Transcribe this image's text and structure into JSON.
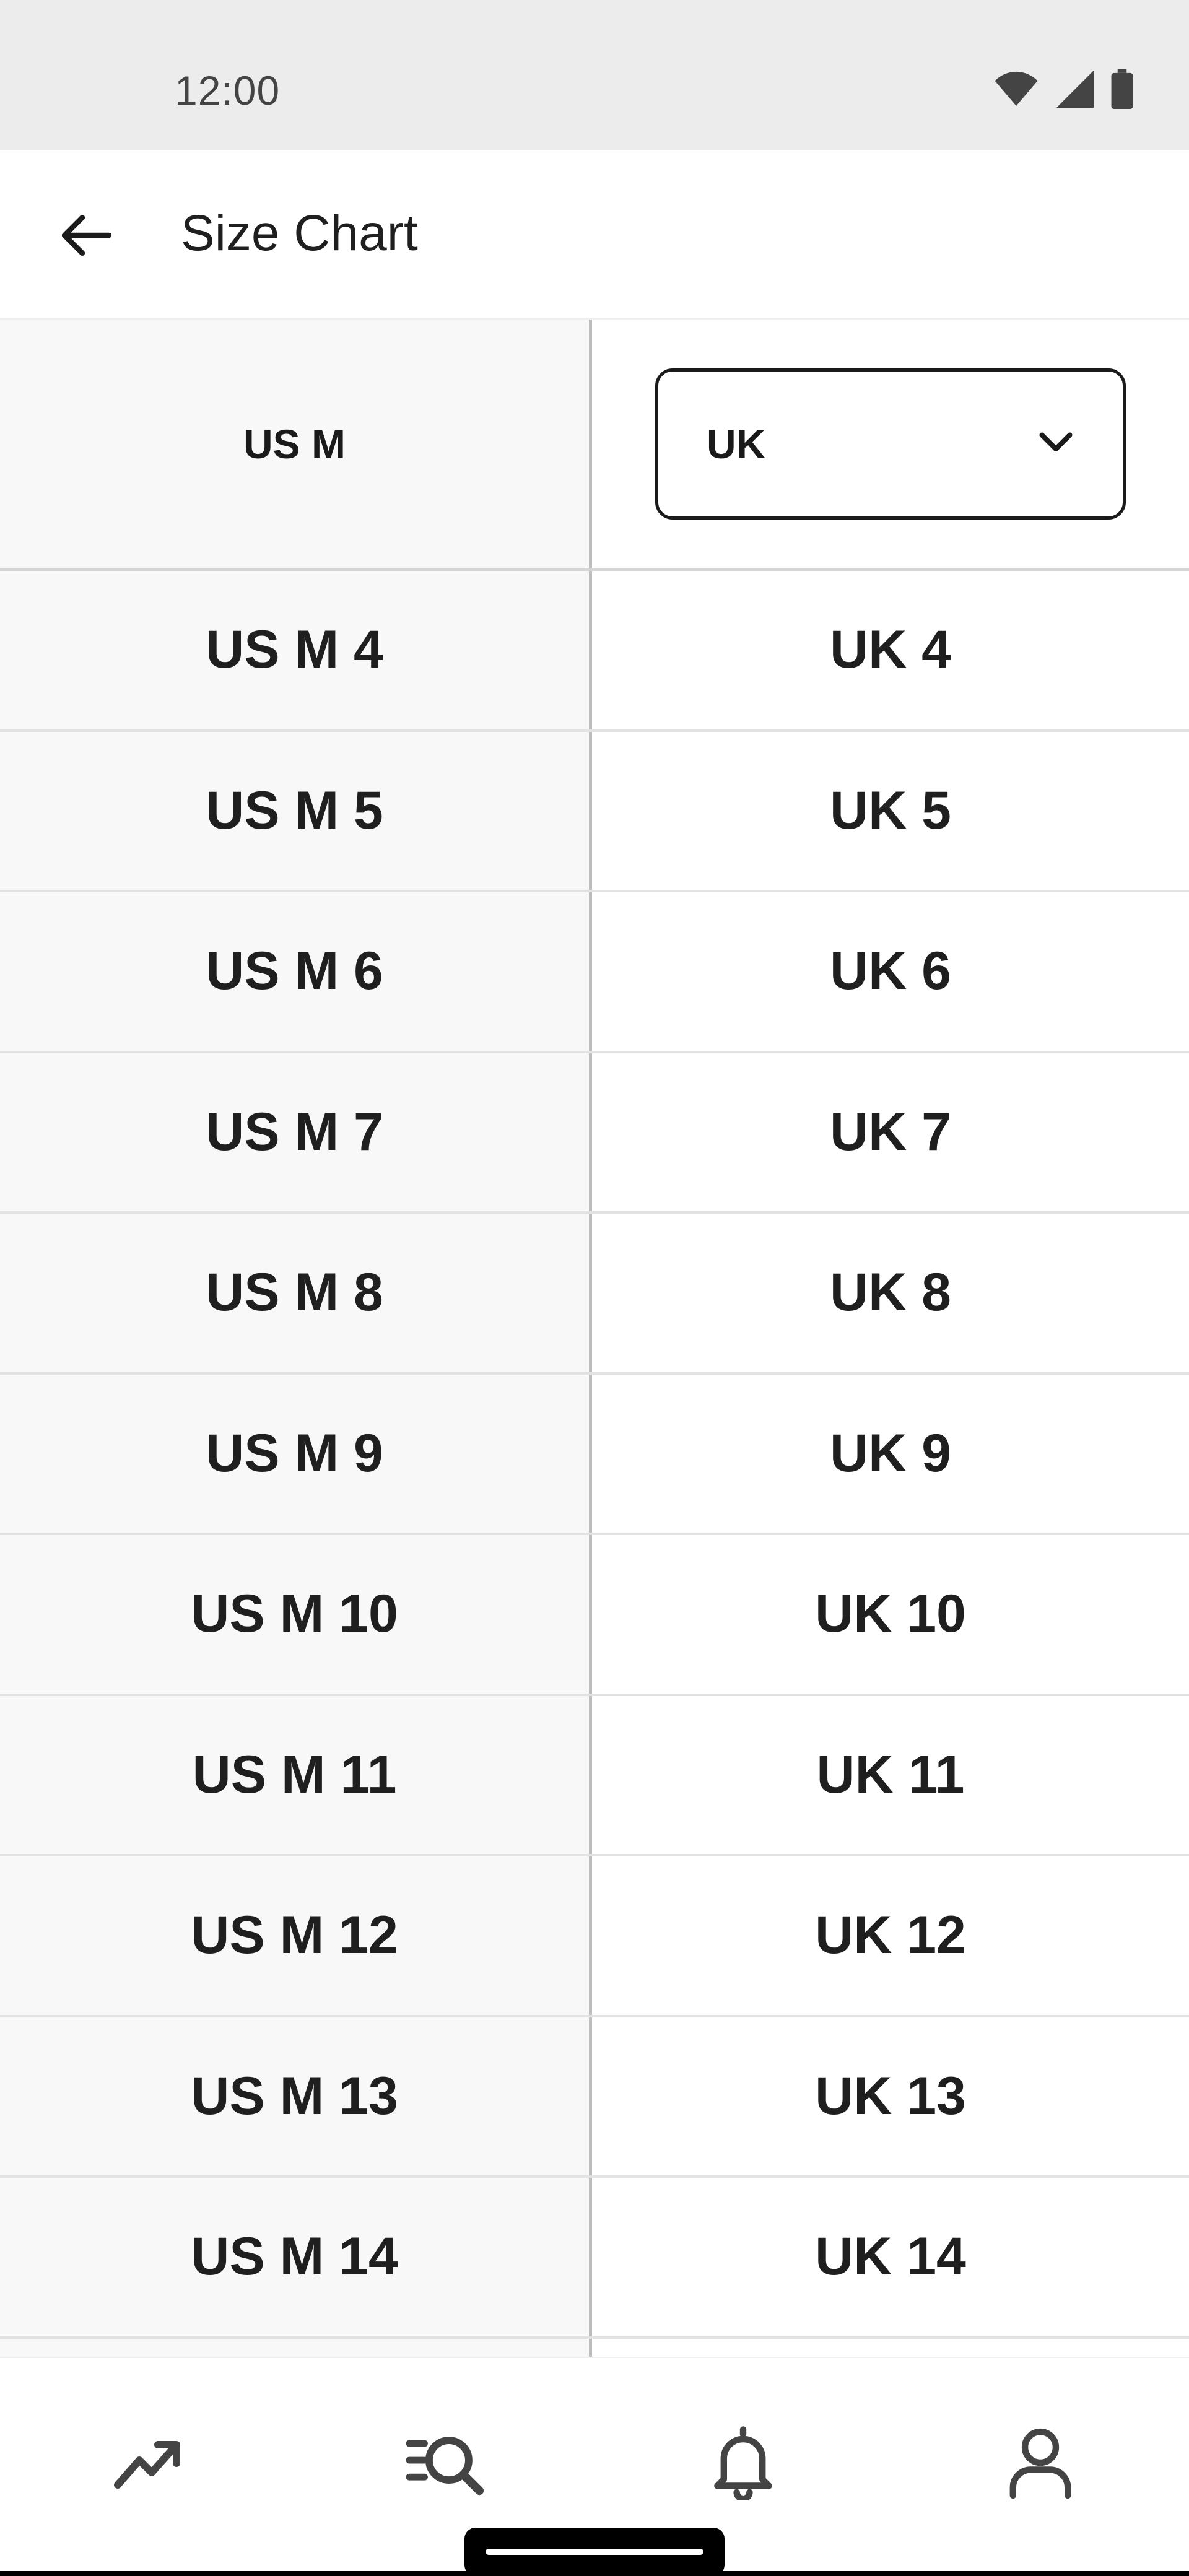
{
  "status_bar": {
    "time": "12:00",
    "icons": [
      "wifi-icon",
      "cellular-signal-icon",
      "battery-icon"
    ]
  },
  "app_bar": {
    "back_icon": "arrow-left-icon",
    "title": "Size Chart"
  },
  "table": {
    "left_header": "US M",
    "right_select": {
      "value": "UK",
      "icon": "chevron-down-icon"
    },
    "rows": [
      {
        "us": "US M 4",
        "uk": "UK 4"
      },
      {
        "us": "US M 5",
        "uk": "UK 5"
      },
      {
        "us": "US M 6",
        "uk": "UK 6"
      },
      {
        "us": "US M 7",
        "uk": "UK 7"
      },
      {
        "us": "US M 8",
        "uk": "UK 8"
      },
      {
        "us": "US M 9",
        "uk": "UK 9"
      },
      {
        "us": "US M 10",
        "uk": "UK 10"
      },
      {
        "us": "US M 11",
        "uk": "UK 11"
      },
      {
        "us": "US M 12",
        "uk": "UK 12"
      },
      {
        "us": "US M 13",
        "uk": "UK 13"
      },
      {
        "us": "US M 14",
        "uk": "UK 14"
      }
    ]
  },
  "bottom_nav": {
    "items": [
      "trending-icon",
      "search-list-icon",
      "bell-icon",
      "profile-icon"
    ]
  },
  "colors": {
    "status_bar_bg": "#ececec",
    "left_column_bg": "#f8f8f8",
    "text": "#1a1a1a",
    "divider": "#e2e2e2"
  }
}
